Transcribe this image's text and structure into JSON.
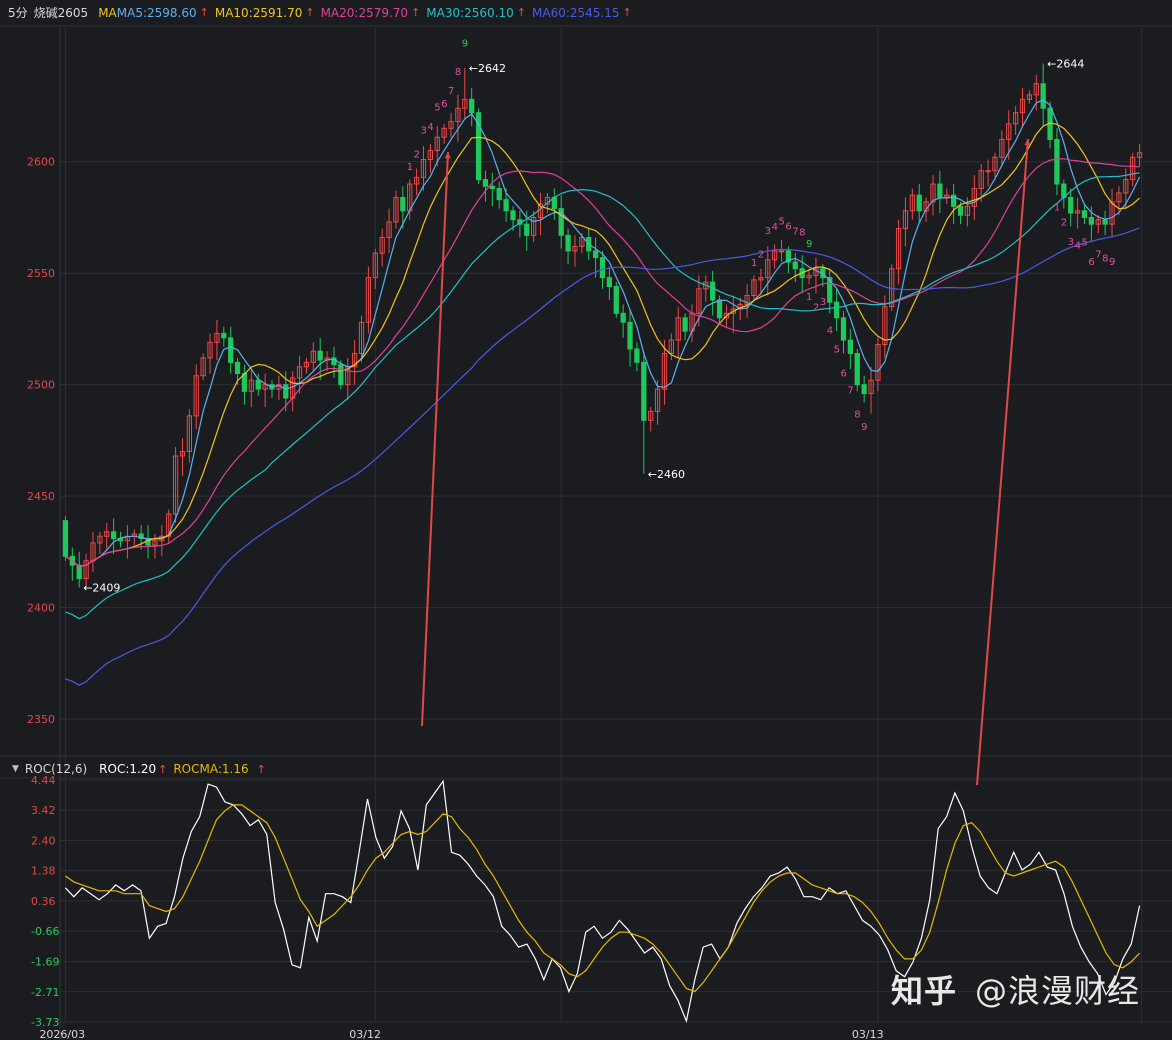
{
  "header": {
    "period": "5分",
    "symbol": "烧碱2605",
    "ma_label": "MA",
    "ma_items": [
      {
        "text": "MA5:2598.60",
        "color": "#5ab0f0"
      },
      {
        "text": "MA10:2591.70",
        "color": "#f0c419"
      },
      {
        "text": "MA20:2579.70",
        "color": "#e0409a"
      },
      {
        "text": "MA30:2560.10",
        "color": "#22c0c6"
      },
      {
        "text": "MA60:2545.15",
        "color": "#4a5ae6"
      }
    ],
    "up_arrow": "↑"
  },
  "roc_header": {
    "toggle": "▼",
    "name": "ROC(12,6)",
    "roc": "ROC:1.20",
    "rocma": "ROCMA:1.16",
    "up_arrow": "↑"
  },
  "colors": {
    "background": "#1b1c20",
    "up": "#f04848",
    "down": "#1ec85a",
    "grid": "#2c2e34",
    "price_label": "#e04848",
    "roc_label_pos": "#e04848",
    "roc_label_neg": "#2ec860",
    "roc_line": "#ffffff",
    "rocma_line": "#e6b800",
    "td_red": "#e050a0",
    "td_green": "#2ec860",
    "arrow": "#e04848"
  },
  "chart_data": [
    {
      "type": "candlestick",
      "title": "烧碱2605 5分",
      "ylim": [
        2337,
        2660
      ],
      "y_ticks": [
        2350,
        2400,
        2450,
        2500,
        2550,
        2600
      ],
      "x_tick_labels": [
        "2026/03",
        "03/12",
        "03/13"
      ],
      "x_tick_index": [
        0,
        45,
        118
      ],
      "marks": [
        {
          "label": "2409",
          "index": 2,
          "price": 2409
        },
        {
          "label": "2642",
          "index": 58,
          "price": 2642
        },
        {
          "label": "2460",
          "index": 84,
          "price": 2460
        },
        {
          "label": "2644",
          "index": 142,
          "price": 2644
        }
      ],
      "moving_averages": [
        "MA5",
        "MA10",
        "MA20",
        "MA30",
        "MA60"
      ],
      "closes": [
        2423,
        2419,
        2413,
        2421,
        2429,
        2432,
        2434,
        2431,
        2430,
        2432,
        2433,
        2431,
        2428,
        2430,
        2432,
        2442,
        2468,
        2470,
        2486,
        2504,
        2512,
        2519,
        2523,
        2521,
        2510,
        2505,
        2497,
        2502,
        2498,
        2500,
        2498,
        2500,
        2494,
        2503,
        2508,
        2510,
        2515,
        2511,
        2512,
        2509,
        2500,
        2508,
        2514,
        2528,
        2548,
        2559,
        2566,
        2573,
        2584,
        2578,
        2590,
        2593,
        2601,
        2605,
        2611,
        2615,
        2618,
        2624,
        2628,
        2622,
        2592,
        2589,
        2588,
        2583,
        2578,
        2574,
        2572,
        2567,
        2575,
        2581,
        2584,
        2579,
        2567,
        2560,
        2562,
        2566,
        2560,
        2557,
        2548,
        2544,
        2532,
        2528,
        2516,
        2510,
        2484,
        2488,
        2498,
        2514,
        2520,
        2530,
        2524,
        2532,
        2543,
        2546,
        2538,
        2530,
        2532,
        2534,
        2536,
        2540,
        2547,
        2548,
        2556,
        2560,
        2560,
        2555,
        2552,
        2548,
        2549,
        2552,
        2548,
        2537,
        2530,
        2520,
        2514,
        2500,
        2496,
        2502,
        2518,
        2535,
        2552,
        2570,
        2578,
        2585,
        2578,
        2582,
        2590,
        2584,
        2585,
        2580,
        2576,
        2580,
        2588,
        2596,
        2596,
        2602,
        2610,
        2617,
        2622,
        2628,
        2630,
        2635,
        2624,
        2610,
        2590,
        2584,
        2577,
        2578,
        2575,
        2572,
        2574,
        2572,
        2582,
        2586,
        2592,
        2602,
        2604
      ]
    },
    {
      "type": "line",
      "title": "ROC(12,6)",
      "ylim": [
        -3.73,
        4.44
      ],
      "y_ticks": [
        4.44,
        3.42,
        2.4,
        1.38,
        0.36,
        -0.66,
        -1.69,
        -2.71,
        -3.73
      ],
      "series": [
        {
          "name": "ROC",
          "values": [
            0.8,
            0.5,
            0.8,
            0.6,
            0.4,
            0.6,
            0.9,
            0.7,
            0.9,
            0.7,
            -0.9,
            -0.5,
            -0.4,
            0.5,
            1.8,
            2.7,
            3.2,
            4.3,
            4.2,
            3.7,
            3.6,
            3.3,
            2.9,
            3.1,
            2.6,
            0.3,
            -0.6,
            -1.8,
            -1.9,
            -0.2,
            -1.0,
            0.6,
            0.6,
            0.5,
            0.3,
            2.0,
            3.8,
            2.5,
            1.8,
            2.2,
            3.4,
            2.8,
            1.4,
            3.6,
            4.0,
            4.4,
            2.0,
            1.9,
            1.6,
            1.2,
            0.9,
            0.5,
            -0.5,
            -0.8,
            -1.2,
            -1.1,
            -1.6,
            -2.3,
            -1.6,
            -1.9,
            -2.7,
            -2.1,
            -0.7,
            -0.5,
            -0.9,
            -0.7,
            -0.3,
            -0.6,
            -1.0,
            -1.4,
            -1.2,
            -1.6,
            -2.5,
            -3.0,
            -3.7,
            -2.3,
            -1.2,
            -1.1,
            -1.6,
            -1.2,
            -0.4,
            0.1,
            0.5,
            0.8,
            1.2,
            1.3,
            1.5,
            1.1,
            0.5,
            0.5,
            0.4,
            0.8,
            0.6,
            0.7,
            0.2,
            -0.3,
            -0.5,
            -0.8,
            -1.3,
            -2.0,
            -2.2,
            -1.7,
            -0.9,
            0.4,
            2.8,
            3.2,
            4.0,
            3.4,
            2.2,
            1.2,
            0.8,
            0.6,
            1.3,
            2.0,
            1.4,
            1.6,
            2.0,
            1.5,
            1.4,
            0.6,
            -0.5,
            -1.2,
            -1.7,
            -2.1,
            -2.8,
            -2.4,
            -1.6,
            -1.1,
            0.2
          ]
        },
        {
          "name": "ROCMA",
          "values": [
            1.2,
            1.0,
            0.9,
            0.8,
            0.7,
            0.7,
            0.7,
            0.6,
            0.6,
            0.6,
            0.2,
            0.1,
            0.0,
            0.1,
            0.5,
            1.1,
            1.7,
            2.4,
            3.1,
            3.4,
            3.6,
            3.6,
            3.4,
            3.2,
            3.0,
            2.5,
            1.8,
            1.1,
            0.4,
            0.0,
            -0.5,
            -0.3,
            -0.1,
            0.2,
            0.5,
            0.9,
            1.4,
            1.8,
            2.0,
            2.3,
            2.6,
            2.7,
            2.6,
            2.7,
            3.0,
            3.3,
            3.2,
            2.8,
            2.5,
            2.1,
            1.6,
            1.2,
            0.7,
            0.2,
            -0.3,
            -0.7,
            -1.0,
            -1.4,
            -1.6,
            -1.8,
            -2.1,
            -2.2,
            -2.0,
            -1.6,
            -1.2,
            -0.9,
            -0.7,
            -0.7,
            -0.8,
            -0.9,
            -1.1,
            -1.4,
            -1.8,
            -2.2,
            -2.6,
            -2.7,
            -2.4,
            -2.0,
            -1.6,
            -1.2,
            -0.7,
            -0.2,
            0.3,
            0.7,
            1.0,
            1.2,
            1.3,
            1.3,
            1.1,
            0.9,
            0.8,
            0.7,
            0.6,
            0.6,
            0.5,
            0.3,
            0.0,
            -0.4,
            -0.9,
            -1.3,
            -1.6,
            -1.6,
            -1.3,
            -0.7,
            0.3,
            1.4,
            2.3,
            2.9,
            3.0,
            2.7,
            2.2,
            1.7,
            1.3,
            1.2,
            1.3,
            1.4,
            1.5,
            1.6,
            1.7,
            1.5,
            1.0,
            0.4,
            -0.2,
            -0.8,
            -1.4,
            -1.8,
            -1.9,
            -1.7,
            -1.4
          ]
        }
      ]
    }
  ],
  "watermark": {
    "logo": "知乎",
    "account": "@浪漫财经"
  }
}
